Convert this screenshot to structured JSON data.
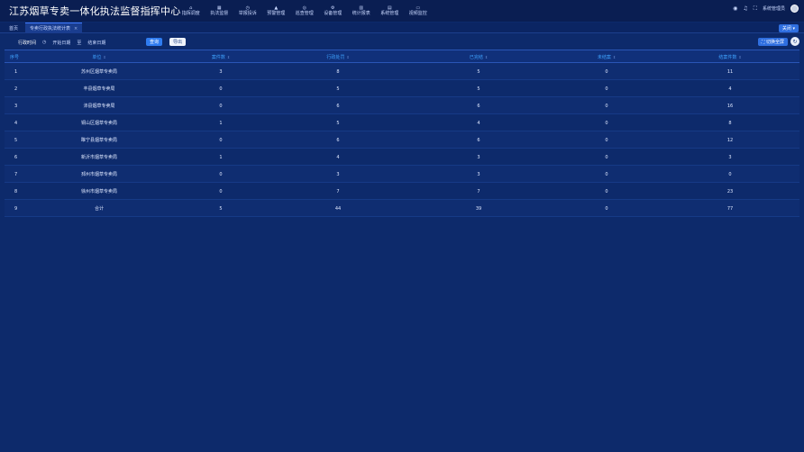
{
  "app_title": "江苏烟草专卖一体化执法监督指挥中心",
  "nav": [
    {
      "icon": "home-icon",
      "glyph": "⌂",
      "label": "指挥调度"
    },
    {
      "icon": "case-icon",
      "glyph": "▦",
      "label": "执法监督"
    },
    {
      "icon": "report-icon",
      "glyph": "◷",
      "label": "举报投诉"
    },
    {
      "icon": "warning-icon",
      "glyph": "▲",
      "label": "预警管理"
    },
    {
      "icon": "patrol-icon",
      "glyph": "◎",
      "label": "巡查管理"
    },
    {
      "icon": "device-icon",
      "glyph": "⚙",
      "label": "设备管理"
    },
    {
      "icon": "stats-icon",
      "glyph": "▥",
      "label": "统计报表"
    },
    {
      "icon": "system-icon",
      "glyph": "▤",
      "label": "系统管理"
    },
    {
      "icon": "video-icon",
      "glyph": "▭",
      "label": "视频监控"
    }
  ],
  "user": {
    "name": "系统管理员"
  },
  "tabs": {
    "home": "首页",
    "active": "专卖行政执法统计表",
    "close": "×"
  },
  "tab_dropdown": "关闭 ▾",
  "filters": {
    "options": [
      "行政时间",
      "开始日期",
      "结束日期"
    ],
    "query_button": "查询",
    "export_button": "导出",
    "fullscreen_button": "⛶ 切换全屏"
  },
  "table": {
    "headers": [
      "序号",
      "单位",
      "案件数",
      "行政处罚",
      "已完结",
      "未结案",
      "结案件数"
    ],
    "rows": [
      [
        "1",
        "苏州区烟草专卖局",
        "3",
        "8",
        "5",
        "0",
        "11"
      ],
      [
        "2",
        "丰县烟草专卖局",
        "0",
        "5",
        "5",
        "0",
        "4"
      ],
      [
        "3",
        "沛县烟草专卖局",
        "0",
        "6",
        "6",
        "0",
        "16"
      ],
      [
        "4",
        "铜山区烟草专卖局",
        "1",
        "5",
        "4",
        "0",
        "8"
      ],
      [
        "5",
        "睢宁县烟草专卖局",
        "0",
        "6",
        "6",
        "0",
        "12"
      ],
      [
        "6",
        "新沂市烟草专卖局",
        "1",
        "4",
        "3",
        "0",
        "3"
      ],
      [
        "7",
        "邳州市烟草专卖局",
        "0",
        "3",
        "3",
        "0",
        "0"
      ],
      [
        "8",
        "徐州市烟草专卖局",
        "0",
        "7",
        "7",
        "0",
        "23"
      ],
      [
        "9",
        "合计",
        "5",
        "44",
        "39",
        "0",
        "77"
      ]
    ]
  },
  "colors": {
    "background": "#0d2a6b",
    "header_text": "#3fa3ff",
    "accent": "#2f7cf0"
  }
}
